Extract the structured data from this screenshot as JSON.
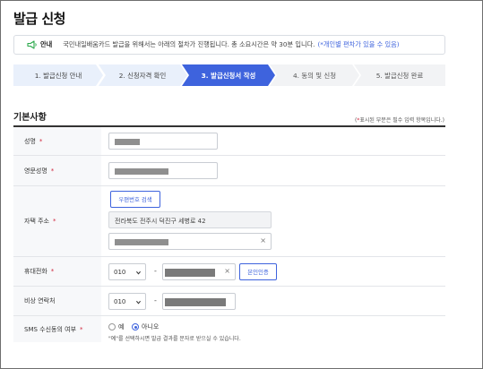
{
  "page": {
    "title": "발급 신청"
  },
  "notice": {
    "label": "안내",
    "text": "국민내일배움카드 발급을 위해서는 아래의 절차가 진행됩니다. 총 소요시간은 약 30분 입니다.",
    "highlight": "(*개인별 편차가 있을 수 있음)",
    "icon": "speaker-icon"
  },
  "steps": [
    {
      "label": "1. 발급신청 안내",
      "state": "done"
    },
    {
      "label": "2. 신청자격 확인",
      "state": "done"
    },
    {
      "label": "3. 발급신청서 작성",
      "state": "active"
    },
    {
      "label": "4. 동의 및 신청",
      "state": "future"
    },
    {
      "label": "5. 발급신청 완료",
      "state": "future"
    }
  ],
  "colors": {
    "accent": "#3e63dd",
    "step_done": "#e9f0fb",
    "step_future": "#f2f3f5",
    "required": "#d0283e"
  },
  "section": {
    "title": "기본사항",
    "required_note_pre": "(",
    "required_note_star": "*",
    "required_note_post": "표시된 부분은 필수 입력 항목입니다.)"
  },
  "form": {
    "name": {
      "label": "성명",
      "required": "*"
    },
    "eng_name": {
      "label": "영문성명",
      "required": "*"
    },
    "address": {
      "label": "자택 주소",
      "required": "*",
      "zip_button": "우편번호 검색",
      "line1": "전라북도 전주시 덕진구 세병로 42",
      "clear": "×"
    },
    "mobile": {
      "label": "휴대전화",
      "required": "*",
      "prefix": "010",
      "dash": "-",
      "clear": "×",
      "verify_button": "본인인증"
    },
    "emergency": {
      "label": "비상 연락처",
      "prefix": "010",
      "dash": "-"
    },
    "sms": {
      "label": "SMS 수신동의 여부",
      "required": "*",
      "option_yes": "예",
      "option_no": "아니오",
      "selected": "아니오",
      "help": "\"예\"를 선택하시면 발급 결과를 문자로 받으실 수 있습니다."
    }
  }
}
